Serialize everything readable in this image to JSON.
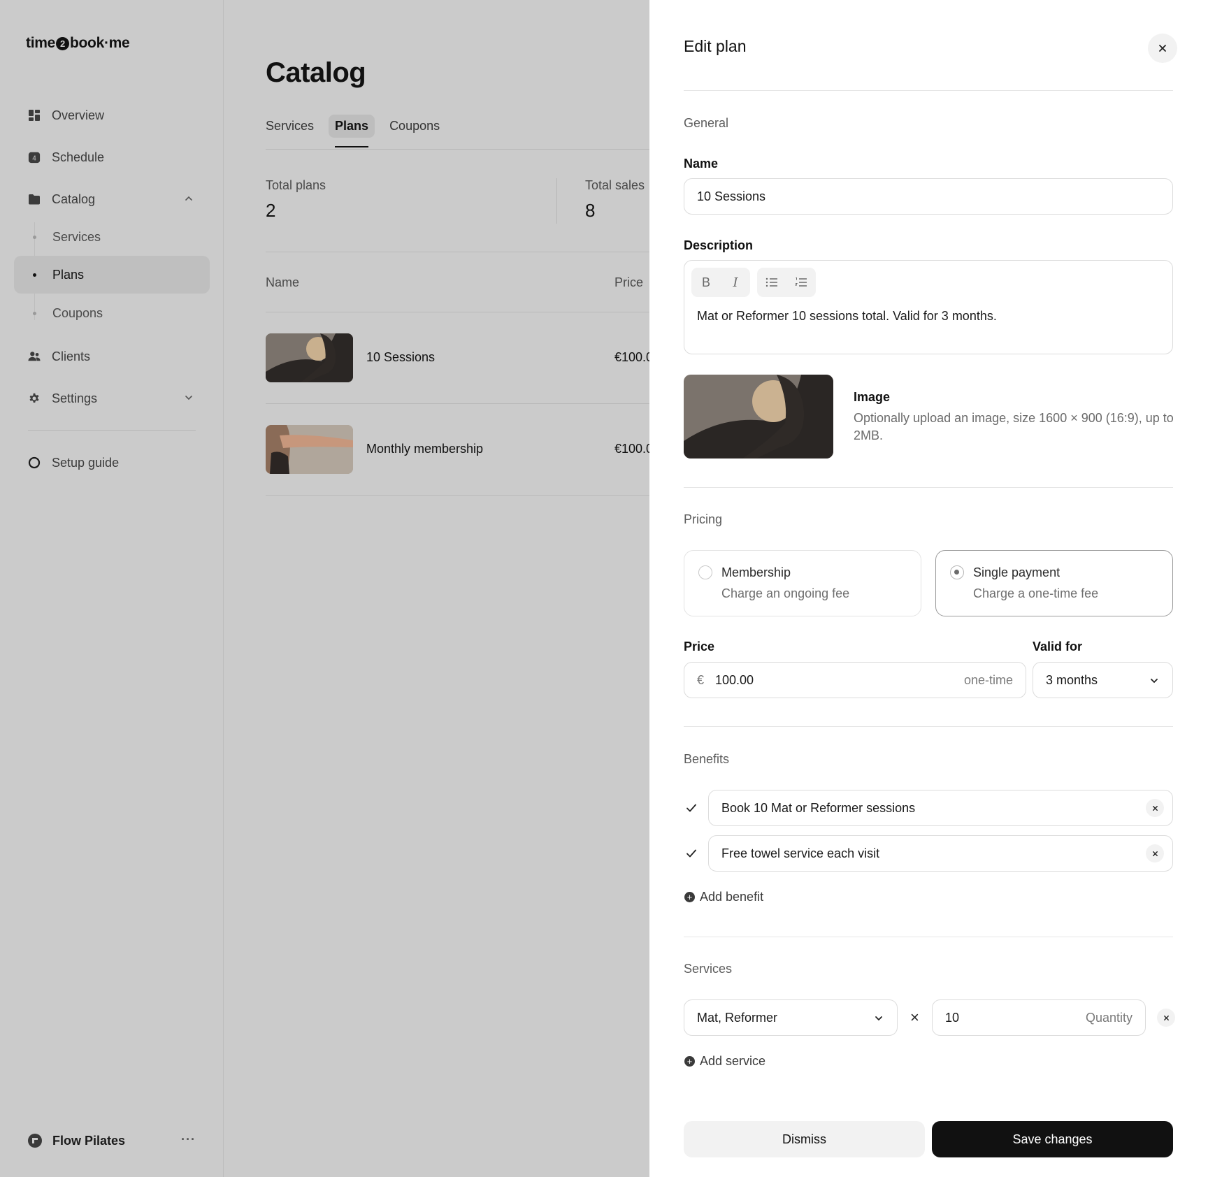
{
  "app": {
    "logo_left": "time",
    "logo_badge": "2",
    "logo_right": "book·me"
  },
  "sidebar": {
    "items": [
      {
        "label": "Overview",
        "icon": "grid-icon"
      },
      {
        "label": "Schedule",
        "icon": "calendar-icon",
        "badge": "4"
      },
      {
        "label": "Catalog",
        "icon": "folder-icon",
        "expanded": true
      },
      {
        "label": "Clients",
        "icon": "users-icon"
      },
      {
        "label": "Settings",
        "icon": "gear-icon"
      }
    ],
    "catalog_subitems": [
      "Services",
      "Plans",
      "Coupons"
    ],
    "active_subitem": "Plans",
    "setup_guide": "Setup guide",
    "workspace_name": "Flow Pilates",
    "workspace_more": "···"
  },
  "main": {
    "title": "Catalog",
    "tabs": [
      "Services",
      "Plans",
      "Coupons"
    ],
    "active_tab": "Plans",
    "stats": [
      {
        "label": "Total plans",
        "value": "2"
      },
      {
        "label": "Total sales",
        "value": "8"
      }
    ],
    "table": {
      "columns": [
        "Name",
        "Price"
      ],
      "rows": [
        {
          "name": "10 Sessions",
          "price": "€100.0"
        },
        {
          "name": "Monthly membership",
          "price": "€100.0"
        }
      ]
    }
  },
  "drawer": {
    "title": "Edit plan",
    "general_heading": "General",
    "name_label": "Name",
    "name_value": "10 Sessions",
    "description_label": "Description",
    "description_value": "Mat or Reformer 10 sessions total. Valid for 3 months.",
    "toolbar": {
      "bold": "B",
      "italic": "I"
    },
    "image_title": "Image",
    "image_desc": "Optionally upload an image, size 1600 × 900 (16:9), up to 2MB.",
    "pricing_heading": "Pricing",
    "pricing_options": [
      {
        "title": "Membership",
        "subtitle": "Charge an ongoing fee",
        "selected": false
      },
      {
        "title": "Single payment",
        "subtitle": "Charge a one-time fee",
        "selected": true
      }
    ],
    "price_label": "Price",
    "currency": "€",
    "price_value": "100.00",
    "price_suffix": "one-time",
    "valid_label": "Valid for",
    "valid_value": "3 months",
    "benefits_heading": "Benefits",
    "benefits": [
      "Book 10 Mat or Reformer sessions",
      "Free towel service each visit"
    ],
    "add_benefit": "Add benefit",
    "services_heading": "Services",
    "service_select": "Mat, Reformer",
    "times": "×",
    "quantity_value": "10",
    "quantity_placeholder": "Quantity",
    "add_service": "Add service",
    "dismiss": "Dismiss",
    "save": "Save changes"
  }
}
